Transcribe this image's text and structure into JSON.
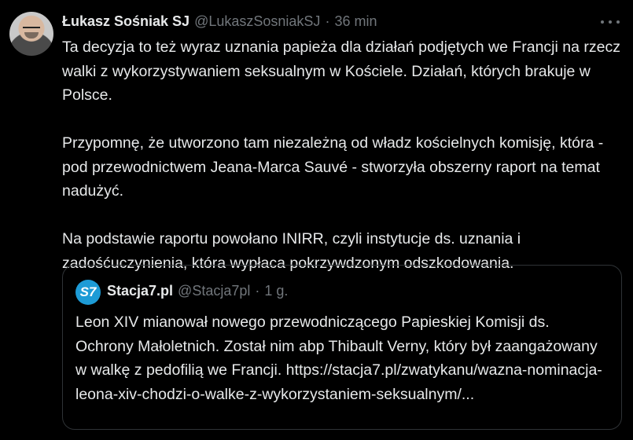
{
  "tweet": {
    "author_name": "Łukasz Sośniak SJ",
    "author_handle": "@LukaszSosniakSJ",
    "separator": "·",
    "time": "36 min",
    "paragraphs": [
      "Ta decyzja to też wyraz uznania papieża dla działań podjętych we Francji na rzecz walki z wykorzystywaniem seksualnym w Kościele. Działań, których brakuje w Polsce.",
      "Przypomnę, że utworzono tam niezależną od władz kościelnych komisję, która - pod przewodnictwem Jeana-Marca Sauvé - stworzyła obszerny raport na temat nadużyć.",
      "Na podstawie raportu powołano INIRR, czyli instytucje ds. uznania i zadośćuczynienia, która wypłaca pokrzywdzonym odszkodowania."
    ],
    "more_icon": "more-horizontal-icon"
  },
  "quote": {
    "logo_text": "S7",
    "author_name": "Stacja7.pl",
    "author_handle": "@Stacja7pl",
    "separator": "·",
    "time": "1 g.",
    "text": "Leon XIV mianował nowego przewodniczącego Papieskiej Komisji ds. Ochrony Małoletnich. Został nim abp Thibault Verny, który był zaangażowany w walkę z pedofilią we Francji. https://stacja7.pl/zwatykanu/wazna-nominacja-leona-xiv-chodzi-o-walke-z-wykorzystaniem-seksualnym/..."
  },
  "colors": {
    "background": "#000000",
    "text_primary": "#e7e9ea",
    "text_secondary": "#71767b",
    "border": "#2f3336",
    "logo_bg": "#1d9bd6"
  }
}
